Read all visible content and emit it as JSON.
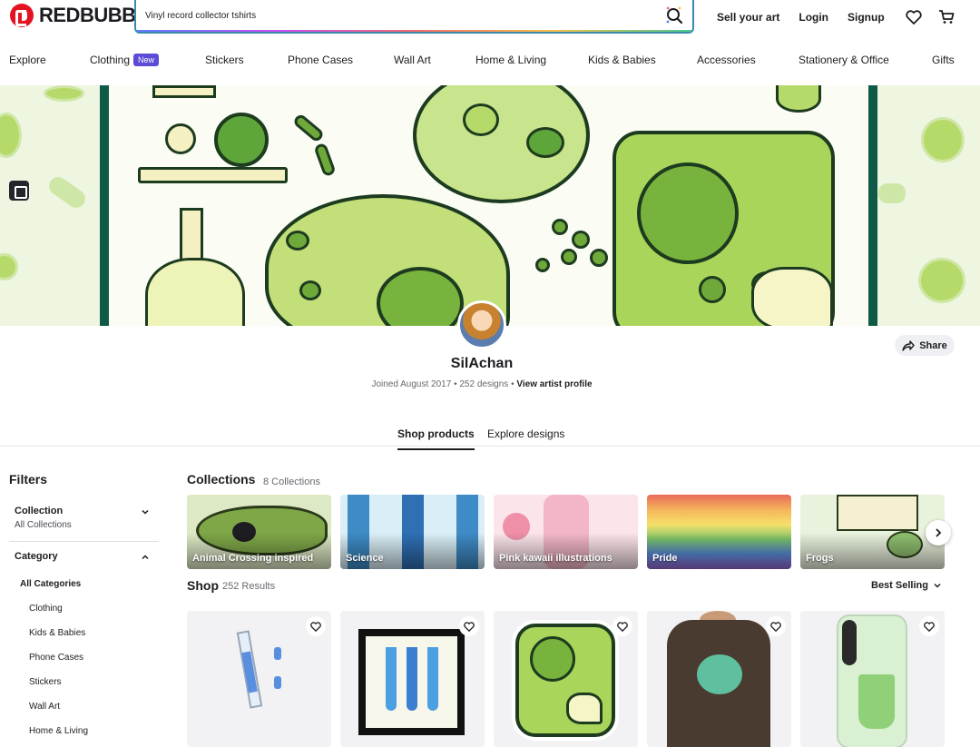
{
  "header": {
    "logo_text": "REDBUBBLE",
    "search_value": "Vinyl record collector tshirts",
    "links": [
      "Sell your art",
      "Login",
      "Signup"
    ]
  },
  "nav": {
    "items": [
      "Explore",
      "Clothing",
      "Stickers",
      "Phone Cases",
      "Wall Art",
      "Home & Living",
      "Kids & Babies",
      "Accessories",
      "Stationery & Office",
      "Gifts"
    ],
    "new_badge": "New"
  },
  "artist": {
    "name": "SilAchan",
    "joined": "Joined August 2017",
    "designs": "252 designs",
    "profile_link": "View artist profile",
    "share": "Share"
  },
  "tabs": [
    "Shop products",
    "Explore designs"
  ],
  "filters": {
    "title": "Filters",
    "collection_title": "Collection",
    "collection_value": "All Collections",
    "category_title": "Category",
    "categories": [
      "All Categories",
      "Clothing",
      "Kids & Babies",
      "Phone Cases",
      "Stickers",
      "Wall Art",
      "Home & Living"
    ]
  },
  "collections": {
    "title": "Collections",
    "count": "8 Collections",
    "items": [
      {
        "label": "Animal Crossing inspired",
        "color": "#7fa748"
      },
      {
        "label": "Science",
        "color": "#3e8bc6"
      },
      {
        "label": "Pink kawaii illustrations",
        "color": "#f3b6c6"
      },
      {
        "label": "Pride",
        "color": "#e96a5a"
      },
      {
        "label": "Frogs",
        "color": "#8fbf6e"
      }
    ]
  },
  "shop": {
    "title": "Shop",
    "count": "252 Results",
    "sort": "Best Selling"
  },
  "colors": {
    "brand": "#e41321",
    "accent": "#5b4bd6",
    "banner_green": "#a9d65a"
  }
}
